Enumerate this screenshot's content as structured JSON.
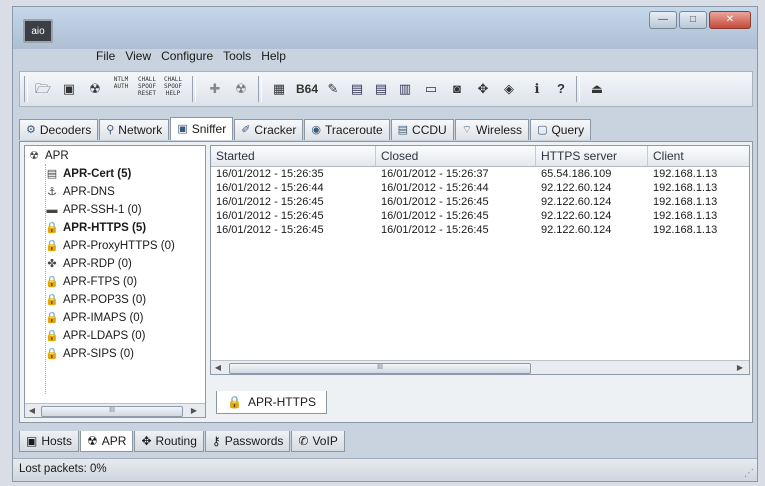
{
  "window": {
    "app_icon_label": "aio",
    "buttons": {
      "minimize": "—",
      "maximize": "□",
      "close": "✕"
    }
  },
  "menu": [
    "File",
    "View",
    "Configure",
    "Tools",
    "Help"
  ],
  "toolbar": {
    "ntlm_auth": "NTLM AUTH",
    "chall_spoof_reset": "CHALL SPOOF RESET",
    "chall_spoof_help": "CHALL SPOOF HELP",
    "b64": "B64"
  },
  "top_tabs": [
    {
      "label": "Decoders",
      "icon": "decoders-icon"
    },
    {
      "label": "Network",
      "icon": "network-icon"
    },
    {
      "label": "Sniffer",
      "icon": "sniffer-icon"
    },
    {
      "label": "Cracker",
      "icon": "cracker-icon"
    },
    {
      "label": "Traceroute",
      "icon": "traceroute-icon"
    },
    {
      "label": "CCDU",
      "icon": "ccdu-icon"
    },
    {
      "label": "Wireless",
      "icon": "wireless-icon"
    },
    {
      "label": "Query",
      "icon": "query-icon"
    }
  ],
  "active_top_tab": "Sniffer",
  "tree": {
    "root": "APR",
    "items": [
      {
        "label": "APR-Cert (5)",
        "bold": true,
        "icon": "certificate-icon"
      },
      {
        "label": "APR-DNS",
        "bold": false,
        "icon": "dns-icon"
      },
      {
        "label": "APR-SSH-1 (0)",
        "bold": false,
        "icon": "ssh-icon"
      },
      {
        "label": "APR-HTTPS (5)",
        "bold": true,
        "icon": "lock-icon"
      },
      {
        "label": "APR-ProxyHTTPS (0)",
        "bold": false,
        "icon": "lock-icon"
      },
      {
        "label": "APR-RDP (0)",
        "bold": false,
        "icon": "rdp-icon"
      },
      {
        "label": "APR-FTPS (0)",
        "bold": false,
        "icon": "lock-icon"
      },
      {
        "label": "APR-POP3S (0)",
        "bold": false,
        "icon": "lock-icon"
      },
      {
        "label": "APR-IMAPS (0)",
        "bold": false,
        "icon": "lock-icon"
      },
      {
        "label": "APR-LDAPS (0)",
        "bold": false,
        "icon": "lock-icon"
      },
      {
        "label": "APR-SIPS (0)",
        "bold": false,
        "icon": "lock-icon"
      }
    ],
    "scroll_thumb_label": "III"
  },
  "grid": {
    "columns": [
      "Started",
      "Closed",
      "HTTPS server",
      "Client"
    ],
    "rows": [
      [
        "16/01/2012 - 15:26:35",
        "16/01/2012 - 15:26:37",
        "65.54.186.109",
        "192.168.1.13"
      ],
      [
        "16/01/2012 - 15:26:44",
        "16/01/2012 - 15:26:44",
        "92.122.60.124",
        "192.168.1.13"
      ],
      [
        "16/01/2012 - 15:26:45",
        "16/01/2012 - 15:26:45",
        "92.122.60.124",
        "192.168.1.13"
      ],
      [
        "16/01/2012 - 15:26:45",
        "16/01/2012 - 15:26:45",
        "92.122.60.124",
        "192.168.1.13"
      ],
      [
        "16/01/2012 - 15:26:45",
        "16/01/2012 - 15:26:45",
        "92.122.60.124",
        "192.168.1.13"
      ]
    ],
    "scroll_thumb_label": "III"
  },
  "sub_tab": "APR-HTTPS",
  "bottom_tabs": [
    {
      "label": "Hosts",
      "icon": "hosts-icon"
    },
    {
      "label": "APR",
      "icon": "apr-icon"
    },
    {
      "label": "Routing",
      "icon": "routing-icon"
    },
    {
      "label": "Passwords",
      "icon": "passwords-icon"
    },
    {
      "label": "VoIP",
      "icon": "voip-icon"
    }
  ],
  "active_bottom_tab": "APR",
  "status": "Lost packets:  0%"
}
